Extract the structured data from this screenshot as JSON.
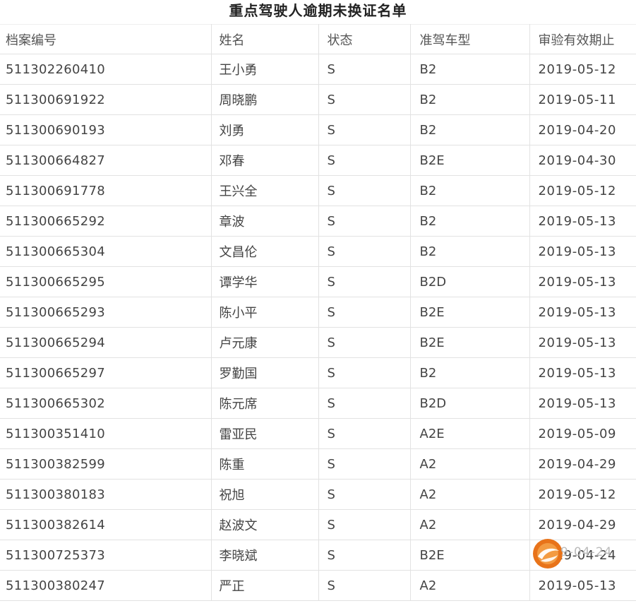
{
  "document": {
    "title": "重点驾驶人逾期未换证名单"
  },
  "table": {
    "headers": [
      "档案编号",
      "姓名",
      "状态",
      "准驾车型",
      "审验有效期止"
    ],
    "rows": [
      [
        "511302260410",
        "王小勇",
        "S",
        "B2",
        "2019-05-12"
      ],
      [
        "511300691922",
        "周晓鹏",
        "S",
        "B2",
        "2019-05-11"
      ],
      [
        "511300690193",
        "刘勇",
        "S",
        "B2",
        "2019-04-20"
      ],
      [
        "511300664827",
        "邓春",
        "S",
        "B2E",
        "2019-04-30"
      ],
      [
        "511300691778",
        "王兴全",
        "S",
        "B2",
        "2019-05-12"
      ],
      [
        "511300665292",
        "章波",
        "S",
        "B2",
        "2019-05-13"
      ],
      [
        "511300665304",
        "文昌伦",
        "S",
        "B2",
        "2019-05-13"
      ],
      [
        "511300665295",
        "谭学华",
        "S",
        "B2D",
        "2019-05-13"
      ],
      [
        "511300665293",
        "陈小平",
        "S",
        "B2E",
        "2019-05-13"
      ],
      [
        "511300665294",
        "卢元康",
        "S",
        "B2E",
        "2019-05-13"
      ],
      [
        "511300665297",
        "罗勤国",
        "S",
        "B2",
        "2019-05-13"
      ],
      [
        "511300665302",
        "陈元席",
        "S",
        "B2D",
        "2019-05-13"
      ],
      [
        "511300351410",
        "雷亚民",
        "S",
        "A2E",
        "2019-05-09"
      ],
      [
        "511300382599",
        "陈重",
        "S",
        "A2",
        "2019-04-29"
      ],
      [
        "511300380183",
        "祝旭",
        "S",
        "A2",
        "2019-05-12"
      ],
      [
        "511300382614",
        "赵波文",
        "S",
        "A2",
        "2019-04-29"
      ],
      [
        "511300725373",
        "李晓斌",
        "S",
        "B2E",
        "2019-04-24"
      ],
      [
        "511300380247",
        "严正",
        "S",
        "A2",
        "2019-05-13"
      ]
    ]
  },
  "watermark": {
    "icon": "swirl-logo-icon",
    "text": "9-04-24",
    "colors": {
      "outer": "#e8731a",
      "inner": "#f4a24a",
      "swirl": "#ffffff"
    }
  }
}
